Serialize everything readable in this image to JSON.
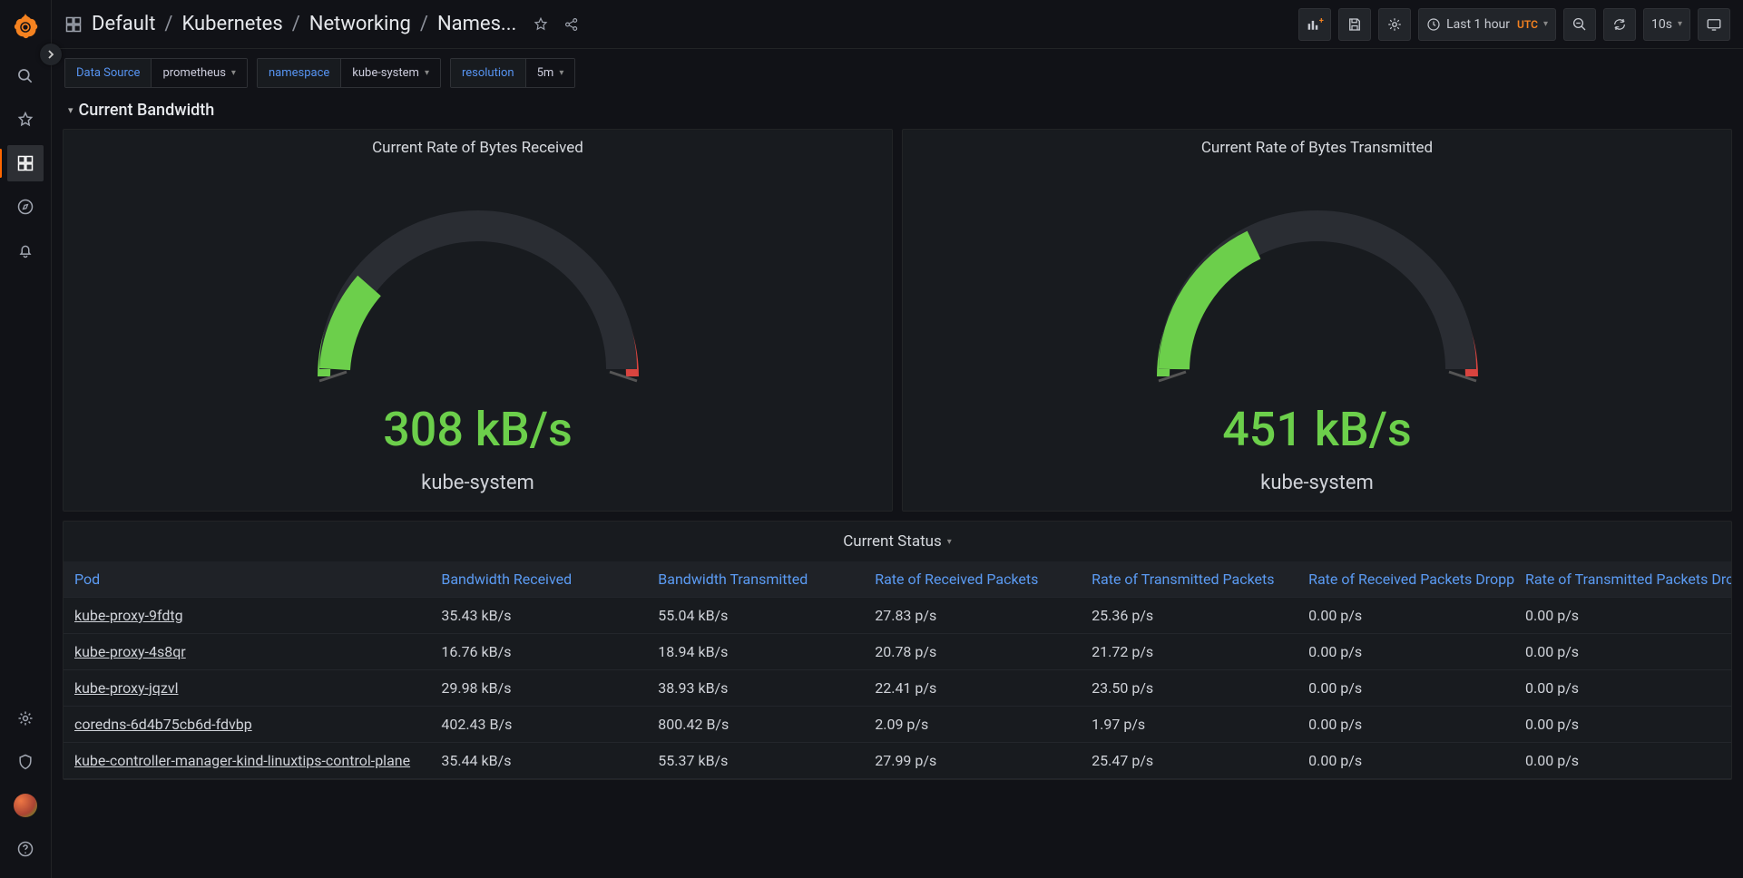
{
  "breadcrumb": [
    "Default",
    "Kubernetes",
    "Networking",
    "Names..."
  ],
  "timepicker": {
    "label": "Last 1 hour",
    "tz": "UTC",
    "refresh": "10s"
  },
  "vars": [
    {
      "label": "Data Source",
      "value": "prometheus"
    },
    {
      "label": "namespace",
      "value": "kube-system"
    },
    {
      "label": "resolution",
      "value": "5m"
    }
  ],
  "section_title": "Current Bandwidth",
  "gauges": [
    {
      "title": "Current Rate of Bytes Received",
      "value": "308 kB/s",
      "sublabel": "kube-system"
    },
    {
      "title": "Current Rate of Bytes Transmitted",
      "value": "451 kB/s",
      "sublabel": "kube-system"
    }
  ],
  "status_title": "Current Status",
  "table": {
    "headers": [
      "Pod",
      "Bandwidth Received",
      "Bandwidth Transmitted",
      "Rate of Received Packets",
      "Rate of Transmitted Packets",
      "Rate of Received Packets Dropped",
      "Rate of Transmitted Packets Dropped"
    ],
    "rows": [
      {
        "pod": "kube-proxy-9fdtg",
        "cells": [
          "35.43 kB/s",
          "55.04 kB/s",
          "27.83 p/s",
          "25.36 p/s",
          "0.00 p/s",
          "0.00 p/s"
        ]
      },
      {
        "pod": "kube-proxy-4s8qr",
        "cells": [
          "16.76 kB/s",
          "18.94 kB/s",
          "20.78 p/s",
          "21.72 p/s",
          "0.00 p/s",
          "0.00 p/s"
        ]
      },
      {
        "pod": "kube-proxy-jqzvl",
        "cells": [
          "29.98 kB/s",
          "38.93 kB/s",
          "22.41 p/s",
          "23.50 p/s",
          "0.00 p/s",
          "0.00 p/s"
        ]
      },
      {
        "pod": "coredns-6d4b75cb6d-fdvbp",
        "cells": [
          "402.43 B/s",
          "800.42 B/s",
          "2.09 p/s",
          "1.97 p/s",
          "0.00 p/s",
          "0.00 p/s"
        ]
      },
      {
        "pod": "kube-controller-manager-kind-linuxtips-control-plane",
        "cells": [
          "35.44 kB/s",
          "55.37 kB/s",
          "27.99 p/s",
          "25.47 p/s",
          "0.00 p/s",
          "0.00 p/s"
        ]
      }
    ]
  },
  "chart_data": [
    {
      "type": "gauge",
      "title": "Current Rate of Bytes Received",
      "value": 308,
      "unit": "kB/s",
      "min": 0,
      "max": 1000,
      "thresholds": [
        0,
        700,
        850,
        1000
      ],
      "colors": [
        "#6ccf4b",
        "#e9c940",
        "#d9443f"
      ],
      "series_label": "kube-system"
    },
    {
      "type": "gauge",
      "title": "Current Rate of Bytes Transmitted",
      "value": 451,
      "unit": "kB/s",
      "min": 0,
      "max": 1000,
      "thresholds": [
        0,
        700,
        850,
        1000
      ],
      "colors": [
        "#6ccf4b",
        "#e9c940",
        "#d9443f"
      ],
      "series_label": "kube-system"
    },
    {
      "type": "table",
      "title": "Current Status",
      "columns": [
        "Pod",
        "Bandwidth Received",
        "Bandwidth Transmitted",
        "Rate of Received Packets",
        "Rate of Transmitted Packets",
        "Rate of Received Packets Dropped",
        "Rate of Transmitted Packets Dropped"
      ],
      "rows": [
        [
          "kube-proxy-9fdtg",
          "35.43 kB/s",
          "55.04 kB/s",
          "27.83 p/s",
          "25.36 p/s",
          "0.00 p/s",
          "0.00 p/s"
        ],
        [
          "kube-proxy-4s8qr",
          "16.76 kB/s",
          "18.94 kB/s",
          "20.78 p/s",
          "21.72 p/s",
          "0.00 p/s",
          "0.00 p/s"
        ],
        [
          "kube-proxy-jqzvl",
          "29.98 kB/s",
          "38.93 kB/s",
          "22.41 p/s",
          "23.50 p/s",
          "0.00 p/s",
          "0.00 p/s"
        ],
        [
          "coredns-6d4b75cb6d-fdvbp",
          "402.43 B/s",
          "800.42 B/s",
          "2.09 p/s",
          "1.97 p/s",
          "0.00 p/s",
          "0.00 p/s"
        ],
        [
          "kube-controller-manager-kind-linuxtips-control-plane",
          "35.44 kB/s",
          "55.37 kB/s",
          "27.99 p/s",
          "25.47 p/s",
          "0.00 p/s",
          "0.00 p/s"
        ]
      ]
    }
  ]
}
